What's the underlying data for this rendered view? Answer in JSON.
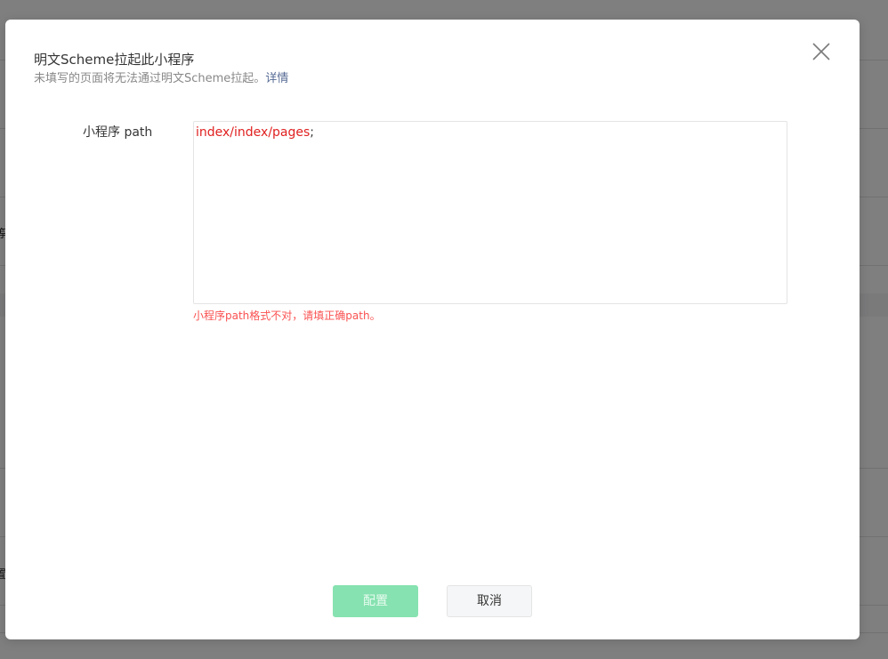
{
  "background": {
    "glyph_1": "等",
    "glyph_2": "置"
  },
  "dialog": {
    "title": "明文Scheme拉起此小程序",
    "subtitle": "未填写的页面将无法通过明文Scheme拉起。",
    "subtitle_link": "详情",
    "close_icon": "close-icon",
    "form": {
      "label": "小程序 path",
      "textarea_value_invalid": "index/index/pages",
      "textarea_value_rest": ";",
      "error_message": "小程序path格式不对，请填正确path。"
    },
    "buttons": {
      "confirm_label": "配置",
      "cancel_label": "取消"
    }
  },
  "colors": {
    "overlay": "#000000",
    "primary_disabled": "#86e2b0",
    "error": "#fa5151",
    "link": "#576b95"
  }
}
